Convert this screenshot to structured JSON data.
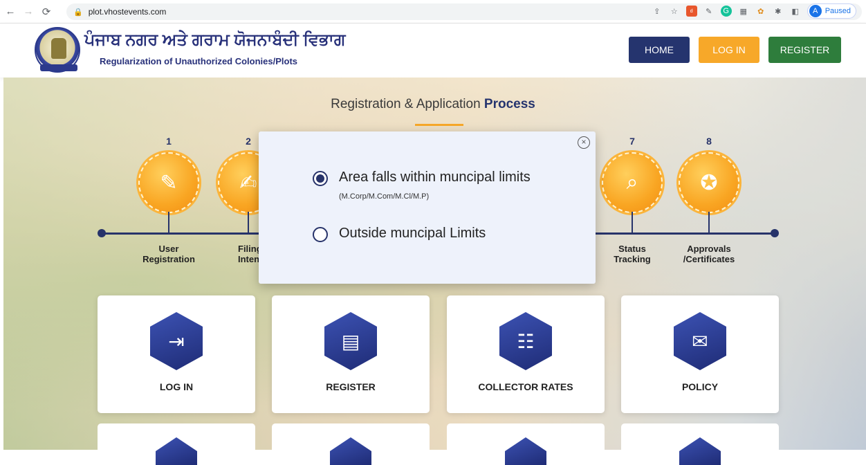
{
  "browser": {
    "url": "plot.vhostevents.com",
    "profile_initial": "A",
    "profile_status": "Paused"
  },
  "header": {
    "title_punjabi": "ਪੰਜਾਬ ਨਗਰ ਅਤੇ ਗਰਾਮ ਯੋਜਨਾਬੰਦੀ ਵਿਭਾਗ",
    "subtitle": "Regularization of Unauthorized Colonies/Plots",
    "buttons": {
      "home": "HOME",
      "login": "LOG IN",
      "register": "REGISTER"
    },
    "colors": {
      "home": "#25346e",
      "login": "#f7a829",
      "register": "#2e7d3c"
    }
  },
  "process": {
    "title_prefix": "Registration & Application",
    "title_emphasis": "Process",
    "steps": [
      {
        "num": "1",
        "label_line1": "User",
        "label_line2": "Registration",
        "icon": "form-edit-icon"
      },
      {
        "num": "2",
        "label_line1": "Filing",
        "label_line2": "Intenti",
        "icon": "document-pen-icon"
      },
      {
        "num": "7",
        "label_line1": "Status",
        "label_line2": "Tracking",
        "icon": "document-search-icon"
      },
      {
        "num": "8",
        "label_line1": "Approvals",
        "label_line2": "/Certificates",
        "icon": "certificate-icon"
      }
    ]
  },
  "modal": {
    "option1": "Area falls within muncipal limits",
    "option1_sub": "(M.Corp/M.Com/M.Cl/M.P)",
    "option2": "Outside muncipal Limits",
    "selected": "option1"
  },
  "cards": [
    {
      "label": "LOG IN",
      "icon": "login-arrow-icon"
    },
    {
      "label": "REGISTER",
      "icon": "register-document-icon"
    },
    {
      "label": "COLLECTOR RATES",
      "icon": "collector-badge-icon"
    },
    {
      "label": "POLICY",
      "icon": "policy-scroll-icon"
    }
  ]
}
